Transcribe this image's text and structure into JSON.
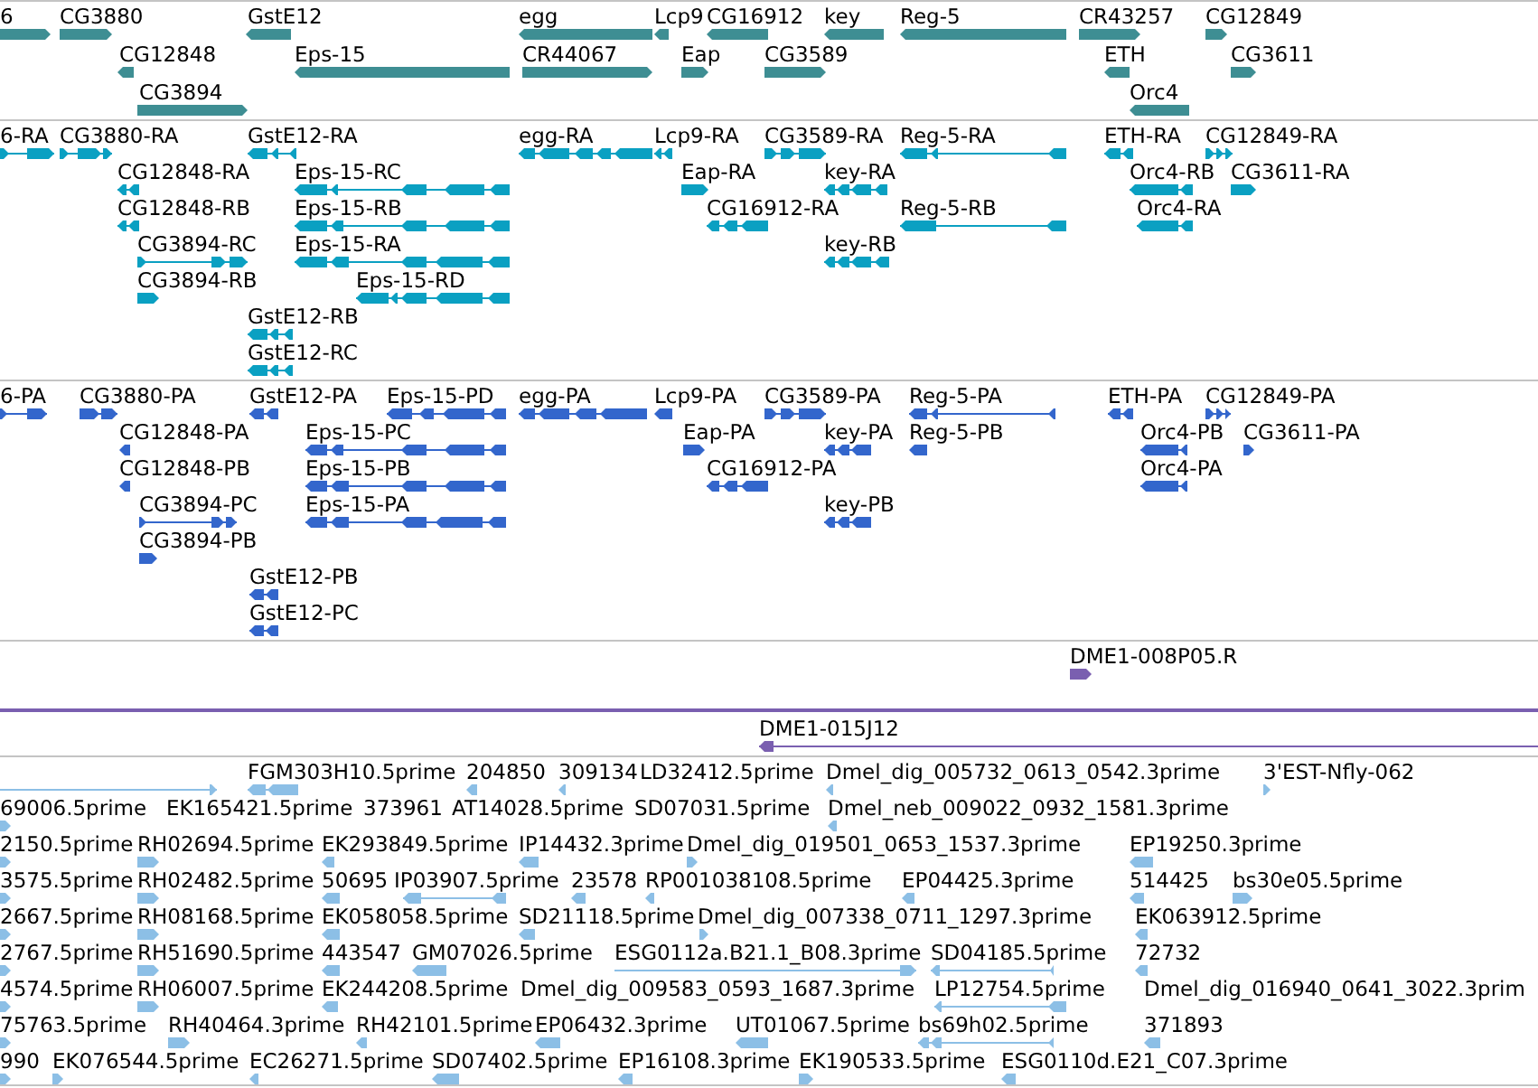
{
  "tracks": [
    {
      "color": "#3e8e93",
      "rows": [
        {
          "features": [
            {
              "label": "6",
              "reverse": false
            },
            {
              "label": "CG3880",
              "reverse": false
            },
            {
              "label": "GstE12",
              "reverse": true
            },
            {
              "label": "egg",
              "reverse": true
            },
            {
              "label": "Lcp9",
              "reverse": true
            },
            {
              "label": "CG16912",
              "reverse": true
            },
            {
              "label": "key",
              "reverse": true
            },
            {
              "label": "Reg-5",
              "reverse": true
            },
            {
              "label": "CR43257",
              "reverse": false
            },
            {
              "label": "CG12849",
              "reverse": false
            }
          ]
        },
        {
          "features": [
            {
              "label": "CG12848",
              "reverse": true
            },
            {
              "label": "Eps-15",
              "reverse": true
            },
            {
              "label": "CR44067",
              "reverse": false
            },
            {
              "label": "Eap",
              "reverse": false
            },
            {
              "label": "CG3589",
              "reverse": false
            },
            {
              "label": "ETH",
              "reverse": true
            },
            {
              "label": "CG3611",
              "reverse": false
            }
          ]
        },
        {
          "features": [
            {
              "label": "CG3894",
              "reverse": false
            },
            {
              "label": "Orc4",
              "reverse": true
            }
          ]
        }
      ]
    },
    {
      "color": "#0aa0c2",
      "rows": [
        {
          "features": [
            {
              "label": "6-RA",
              "reverse": false
            },
            {
              "label": "CG3880-RA",
              "reverse": false
            },
            {
              "label": "GstE12-RA",
              "reverse": true
            },
            {
              "label": "egg-RA",
              "reverse": true
            },
            {
              "label": "Lcp9-RA",
              "reverse": true
            },
            {
              "label": "CG3589-RA",
              "reverse": false
            },
            {
              "label": "Reg-5-RA",
              "reverse": true
            },
            {
              "label": "ETH-RA",
              "reverse": true
            },
            {
              "label": "CG12849-RA",
              "reverse": false
            }
          ]
        },
        {
          "features": [
            {
              "label": "CG12848-RA",
              "reverse": true
            },
            {
              "label": "Eps-15-RC",
              "reverse": true
            },
            {
              "label": "Eap-RA",
              "reverse": false
            },
            {
              "label": "key-RA",
              "reverse": true
            },
            {
              "label": "Orc4-RB",
              "reverse": true
            },
            {
              "label": "CG3611-RA",
              "reverse": false
            }
          ]
        },
        {
          "features": [
            {
              "label": "CG12848-RB",
              "reverse": true
            },
            {
              "label": "Eps-15-RB",
              "reverse": true
            },
            {
              "label": "CG16912-RA",
              "reverse": true
            },
            {
              "label": "Reg-5-RB",
              "reverse": true
            },
            {
              "label": "Orc4-RA",
              "reverse": true
            }
          ]
        },
        {
          "features": [
            {
              "label": "CG3894-RC",
              "reverse": false
            },
            {
              "label": "Eps-15-RA",
              "reverse": true
            },
            {
              "label": "key-RB",
              "reverse": true
            }
          ]
        },
        {
          "features": [
            {
              "label": "CG3894-RB",
              "reverse": false
            },
            {
              "label": "Eps-15-RD",
              "reverse": true
            }
          ]
        },
        {
          "features": [
            {
              "label": "GstE12-RB",
              "reverse": true
            }
          ]
        },
        {
          "features": [
            {
              "label": "GstE12-RC",
              "reverse": true
            }
          ]
        }
      ]
    },
    {
      "color": "#3366cc",
      "rows": [
        {
          "features": [
            {
              "label": "6-PA",
              "reverse": false
            },
            {
              "label": "CG3880-PA",
              "reverse": false
            },
            {
              "label": "GstE12-PA",
              "reverse": true
            },
            {
              "label": "Eps-15-PD",
              "reverse": true
            },
            {
              "label": "egg-PA",
              "reverse": true
            },
            {
              "label": "Lcp9-PA",
              "reverse": true
            },
            {
              "label": "CG3589-PA",
              "reverse": false
            },
            {
              "label": "Reg-5-PA",
              "reverse": true
            },
            {
              "label": "ETH-PA",
              "reverse": true
            },
            {
              "label": "CG12849-PA",
              "reverse": false
            }
          ]
        },
        {
          "features": [
            {
              "label": "CG12848-PA",
              "reverse": true
            },
            {
              "label": "Eps-15-PC",
              "reverse": true
            },
            {
              "label": "Eap-PA",
              "reverse": false
            },
            {
              "label": "key-PA",
              "reverse": true
            },
            {
              "label": "Reg-5-PB",
              "reverse": true
            },
            {
              "label": "Orc4-PB",
              "reverse": true
            },
            {
              "label": "CG3611-PA",
              "reverse": false
            }
          ]
        },
        {
          "features": [
            {
              "label": "CG12848-PB",
              "reverse": true
            },
            {
              "label": "Eps-15-PB",
              "reverse": true
            },
            {
              "label": "CG16912-PA",
              "reverse": true
            },
            {
              "label": "Orc4-PA",
              "reverse": true
            }
          ]
        },
        {
          "features": [
            {
              "label": "CG3894-PC",
              "reverse": false
            },
            {
              "label": "Eps-15-PA",
              "reverse": true
            },
            {
              "label": "key-PB",
              "reverse": true
            }
          ]
        },
        {
          "features": [
            {
              "label": "CG3894-PB",
              "reverse": false
            }
          ]
        },
        {
          "features": [
            {
              "label": "GstE12-PB",
              "reverse": true
            }
          ]
        },
        {
          "features": [
            {
              "label": "GstE12-PC",
              "reverse": true
            }
          ]
        }
      ]
    },
    {
      "color": "#7a5fb0",
      "rows": [
        {
          "features": [
            {
              "label": "DME1-008P05.R",
              "reverse": false
            }
          ]
        },
        {
          "spanning_line": true
        },
        {
          "features": [
            {
              "label": "DME1-015J12",
              "reverse": true
            }
          ]
        }
      ]
    },
    {
      "color": "#8cbfe6",
      "rows": [
        {
          "features": [
            {
              "reverse": false
            },
            {
              "label": "FGM303H10.5prime",
              "reverse": true
            },
            {
              "label": "204850",
              "reverse": true
            },
            {
              "label": "309134",
              "reverse": true
            },
            {
              "label": "LD32412.5prime"
            },
            {
              "label": "Dmel_dig_005732_0613_0542.3prime",
              "reverse": true
            },
            {
              "label": "3'EST-Nfly-062",
              "reverse": false
            }
          ]
        },
        {
          "features": [
            {
              "label": "69006.5prime",
              "reverse": false
            },
            {
              "label": "EK165421.5prime"
            },
            {
              "label": "373961"
            },
            {
              "label": "AT14028.5prime"
            },
            {
              "label": "SD07031.5prime"
            },
            {
              "label": "Dmel_neb_009022_0932_1581.3prime",
              "reverse": true
            }
          ]
        },
        {
          "features": [
            {
              "label": "2150.5prime",
              "reverse": false
            },
            {
              "label": "RH02694.5prime",
              "reverse": false
            },
            {
              "label": "EK293849.5prime",
              "reverse": true
            },
            {
              "label": "IP14432.3prime",
              "reverse": true
            },
            {
              "label": "Dmel_dig_019501_0653_1537.3prime",
              "reverse": false
            },
            {
              "label": "EP19250.3prime",
              "reverse": true
            }
          ]
        },
        {
          "features": [
            {
              "label": "3575.5prime",
              "reverse": false
            },
            {
              "label": "RH02482.5prime",
              "reverse": false
            },
            {
              "label": "50695",
              "reverse": true
            },
            {
              "label": "IP03907.5prime",
              "reverse": true
            },
            {
              "label": "23578",
              "reverse": true
            },
            {
              "label": "RP001038108.5prime",
              "reverse": true
            },
            {
              "label": "EP04425.3prime",
              "reverse": true
            },
            {
              "label": "514425",
              "reverse": true
            },
            {
              "label": "bs30e05.5prime",
              "reverse": false
            }
          ]
        },
        {
          "features": [
            {
              "label": "2667.5prime",
              "reverse": false
            },
            {
              "label": "RH08168.5prime",
              "reverse": false
            },
            {
              "label": "EK058058.5prime",
              "reverse": true
            },
            {
              "label": "SD21118.5prime",
              "reverse": true
            },
            {
              "label": "Dmel_dig_007338_0711_1297.3prime",
              "reverse": false
            },
            {
              "label": "EK063912.5prime",
              "reverse": true
            }
          ]
        },
        {
          "features": [
            {
              "label": "2767.5prime",
              "reverse": false
            },
            {
              "label": "RH51690.5prime",
              "reverse": false
            },
            {
              "label": "443547",
              "reverse": true
            },
            {
              "label": "GM07026.5prime",
              "reverse": true
            },
            {
              "label": "ESG0112a.B21.1_B08.3prime",
              "reverse": false
            },
            {
              "label": "SD04185.5prime",
              "reverse": true
            },
            {
              "label": "72732",
              "reverse": true
            }
          ]
        },
        {
          "features": [
            {
              "label": "4574.5prime",
              "reverse": false
            },
            {
              "label": "RH06007.5prime",
              "reverse": false
            },
            {
              "label": "EK244208.5prime",
              "reverse": true
            },
            {
              "label": "Dmel_dig_009583_0593_1687.3prime"
            },
            {
              "label": "LP12754.5prime",
              "reverse": true
            },
            {
              "label": "Dmel_dig_016940_0641_3022.3prim"
            }
          ]
        },
        {
          "features": [
            {
              "label": "75763.5prime",
              "reverse": false
            },
            {
              "label": "RH40464.3prime",
              "reverse": false
            },
            {
              "label": "RH42101.5prime",
              "reverse": true
            },
            {
              "label": "EP06432.3prime",
              "reverse": true
            },
            {
              "label": "UT01067.5prime",
              "reverse": true
            },
            {
              "label": "bs69h02.5prime",
              "reverse": true
            },
            {
              "label": "371893",
              "reverse": true
            }
          ]
        },
        {
          "features": [
            {
              "label": "990",
              "reverse": false
            },
            {
              "label": "EK076544.5prime",
              "reverse": false
            },
            {
              "label": "EC26271.5prime",
              "reverse": true
            },
            {
              "label": "SD07402.5prime",
              "reverse": true
            },
            {
              "label": "EP16108.3prime",
              "reverse": true
            },
            {
              "label": "EK190533.5prime",
              "reverse": false
            },
            {
              "label": "ESG0110d.E21_C07.3prime",
              "reverse": true
            }
          ]
        }
      ]
    }
  ]
}
